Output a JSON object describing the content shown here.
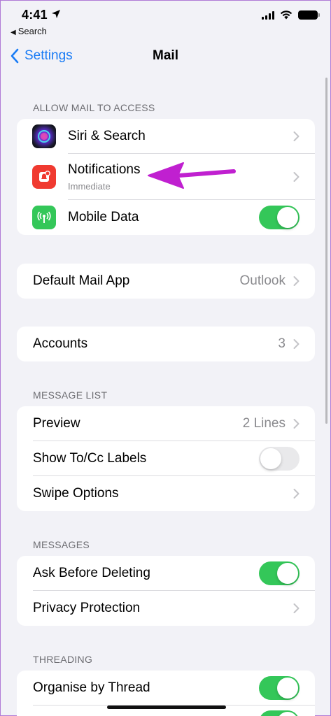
{
  "status_bar": {
    "time": "4:41",
    "back_app": "Search"
  },
  "nav": {
    "back_label": "Settings",
    "title": "Mail"
  },
  "sections": {
    "allow_access": {
      "header": "ALLOW MAIL TO ACCESS",
      "siri": {
        "label": "Siri & Search"
      },
      "notifications": {
        "label": "Notifications",
        "sublabel": "Immediate"
      },
      "mobile_data": {
        "label": "Mobile Data",
        "toggle": "on"
      }
    },
    "default_app": {
      "label": "Default Mail App",
      "value": "Outlook"
    },
    "accounts": {
      "label": "Accounts",
      "value": "3"
    },
    "message_list": {
      "header": "MESSAGE LIST",
      "preview": {
        "label": "Preview",
        "value": "2 Lines"
      },
      "show_tocc": {
        "label": "Show To/Cc Labels",
        "toggle": "off"
      },
      "swipe": {
        "label": "Swipe Options"
      }
    },
    "messages": {
      "header": "MESSAGES",
      "ask_delete": {
        "label": "Ask Before Deleting",
        "toggle": "on"
      },
      "privacy": {
        "label": "Privacy Protection"
      }
    },
    "threading": {
      "header": "THREADING",
      "organise": {
        "label": "Organise by Thread",
        "toggle": "on"
      }
    }
  },
  "colors": {
    "accent": "#1a7cf5",
    "toggle_on": "#34c759",
    "annotation": "#c020d0"
  }
}
